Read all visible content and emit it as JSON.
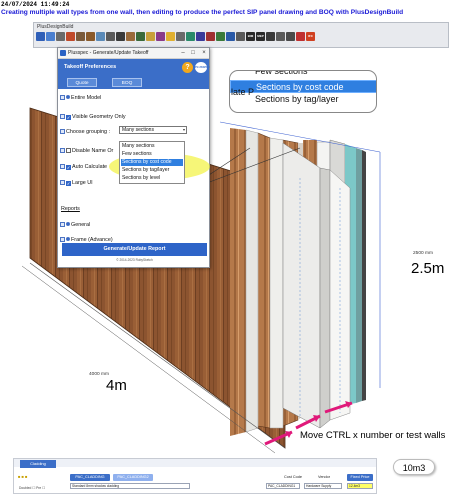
{
  "banner": {
    "timestamp": "24/07/2024  11:49:24",
    "headline": "Creating multiple wall types from one wall, then editing to produce the perfect SIP panel drawing and BOQ with PlusDesignBuild"
  },
  "app": {
    "toolbar_title": "PlusDesignBuild",
    "toolbar_icons": [
      {
        "icon": "2d-icon",
        "color": "#2f5fb8"
      },
      {
        "icon": "wall-icon",
        "color": "#4a7fd0"
      },
      {
        "icon": "floor-icon",
        "color": "#6a6a6a"
      },
      {
        "icon": "roof-icon",
        "color": "#c04a2a"
      },
      {
        "icon": "stairs-icon",
        "color": "#7a5a3a"
      },
      {
        "icon": "door-icon",
        "color": "#8a5a2a"
      },
      {
        "icon": "window-icon",
        "color": "#5a8ab8"
      },
      {
        "icon": "beam-icon",
        "color": "#5a5a5a"
      },
      {
        "icon": "column-icon",
        "color": "#3a3a3a"
      },
      {
        "icon": "truss-icon",
        "color": "#9a6a3a"
      },
      {
        "icon": "frame-icon",
        "color": "#3a6a3a"
      },
      {
        "icon": "panel-icon",
        "color": "#c8a03a"
      },
      {
        "icon": "cladding-icon",
        "color": "#8a3a8a"
      },
      {
        "icon": "insulation-icon",
        "color": "#e0b030"
      },
      {
        "icon": "foundation-icon",
        "color": "#6a6a6a"
      },
      {
        "icon": "measure-icon",
        "color": "#2a8a6a"
      },
      {
        "icon": "edit-icon",
        "color": "#3a3a9a"
      },
      {
        "icon": "layer-icon",
        "color": "#a03030"
      },
      {
        "icon": "tag-icon",
        "color": "#3a7a3a"
      },
      {
        "icon": "section-icon",
        "color": "#2a5aa8"
      },
      {
        "icon": "grid-icon",
        "color": "#5a5a5a"
      },
      {
        "icon": "bim-icon",
        "color": "#2a2a2a"
      },
      {
        "icon": "mep-icon",
        "color": "#2a2a2a"
      },
      {
        "icon": "export-icon",
        "color": "#3a3a3a"
      },
      {
        "icon": "print-icon",
        "color": "#5a5a5a"
      },
      {
        "icon": "settings-icon",
        "color": "#4a4a4a"
      },
      {
        "icon": "report-icon",
        "color": "#c03030"
      },
      {
        "icon": "ifc-icon",
        "color": "#d04020"
      }
    ],
    "toolbar_text_icons": {
      "bim": "BIM",
      "mep": "MEP",
      "ifc": "IFC"
    }
  },
  "dialog": {
    "window_title": "Plusspec - Generate/Update Takeoff",
    "header_title": "Takeoff Preferences",
    "help_label": "?",
    "logo_text": "PLUSSPEC",
    "tabs": [
      {
        "label": "Quote"
      },
      {
        "label": "BOQ"
      }
    ],
    "rows": {
      "entire_model": "Entire Model",
      "visible_geometry": "Visible Geometry Only",
      "choose_grouping": "Choose grouping :",
      "grouping_value": "Many sections",
      "disable_name": "Disable Name Or",
      "auto_calculate": "Auto Calculate",
      "large_ui": "Large UI"
    },
    "reports_label": "Reports",
    "general_label": "General",
    "frame_label": "Frame (Advance)",
    "generate_button": "Generate/Update Report",
    "copyright": "© 2014-2023 RubySketch"
  },
  "dropdown": {
    "items": [
      {
        "label": "Many sections",
        "selected": false
      },
      {
        "label": "Few sections",
        "selected": false
      },
      {
        "label": "Sections by cost code",
        "selected": true
      },
      {
        "label": "Sections by tag/layer",
        "selected": false
      },
      {
        "label": "Sections by level",
        "selected": false
      }
    ]
  },
  "callout": {
    "items": [
      {
        "label": "Few sections",
        "selected": false
      },
      {
        "label": "Sections by cost code",
        "selected": true
      },
      {
        "label": "Sections by tag/layer",
        "selected": false
      }
    ],
    "behind_text": "late P"
  },
  "dimensions": {
    "height_small": "2500 mm",
    "height_big": "2.5m",
    "length_small": "4000 mm",
    "length_big": "4m"
  },
  "annotation": {
    "move_text": "Move CTRL x number or test walls"
  },
  "bottom_panel": {
    "tab_label": "Cladding",
    "icons_text": "■ ■ ■",
    "code_pill": "PAC_CLADDING",
    "code_box": "PAC_CLADDING2",
    "cost_code_label": "Cost Code",
    "vendor_label": "Vendor",
    "fixed_price_label": "Fixed Price",
    "vendor_value": "Hardware Supply",
    "cost_code_value": "PAC_CLADDING1",
    "fixed_price_value": "12.4m3",
    "desc_text": "Standard 8mm shadow cladding",
    "footer_text": "Doubled ☐  Pre  ☐"
  },
  "volume": {
    "value": "10m3"
  }
}
